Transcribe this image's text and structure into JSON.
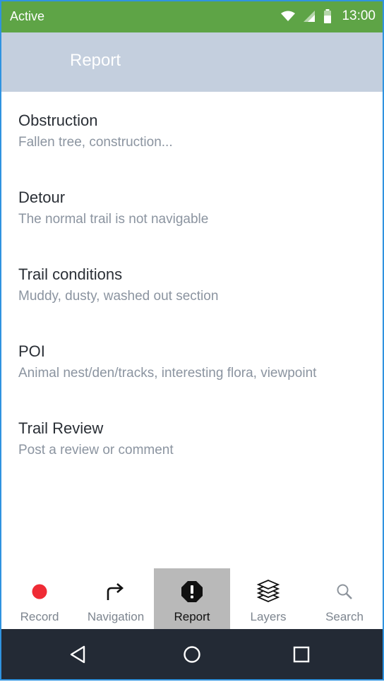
{
  "status": {
    "label": "Active",
    "time": "13:00"
  },
  "appbar": {
    "title": "Report"
  },
  "items": [
    {
      "title": "Obstruction",
      "subtitle": "Fallen tree, construction..."
    },
    {
      "title": "Detour",
      "subtitle": "The normal trail is not navigable"
    },
    {
      "title": "Trail conditions",
      "subtitle": "Muddy, dusty, washed out section"
    },
    {
      "title": "POI",
      "subtitle": "Animal nest/den/tracks, interesting flora, viewpoint"
    },
    {
      "title": "Trail Review",
      "subtitle": "Post a review or comment"
    }
  ],
  "tabs": [
    {
      "label": "Record",
      "icon": "record-icon"
    },
    {
      "label": "Navigation",
      "icon": "turn-right-arrow-icon"
    },
    {
      "label": "Report",
      "icon": "alert-octagon-icon",
      "active": true
    },
    {
      "label": "Layers",
      "icon": "layers-icon"
    },
    {
      "label": "Search",
      "icon": "search-icon"
    }
  ],
  "navbar": {
    "icons": [
      "back-triangle-icon",
      "home-circle-icon",
      "recents-square-icon"
    ]
  },
  "colors": {
    "status_bar": "#5ea446",
    "app_bar": "#c4cfde",
    "active_tab": "#b9b9b9",
    "record_dot": "#ef2b35",
    "nav_bar": "#232a35"
  }
}
